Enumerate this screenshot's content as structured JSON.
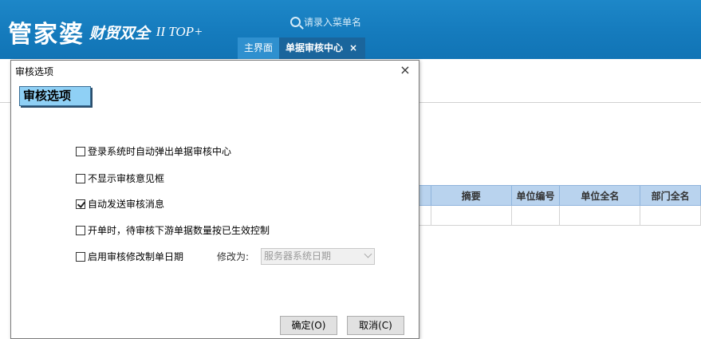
{
  "header": {
    "logo_brand": "管家婆",
    "logo_sub": "财贸双全",
    "logo_version": "II TOP+",
    "search_placeholder": "请录入菜单名",
    "tabs": [
      {
        "label": "主界面"
      },
      {
        "label": "单据审核中心",
        "close": "×"
      }
    ]
  },
  "grid": {
    "columns": [
      "",
      "摘要",
      "单位编号",
      "单位全名",
      "部门全名"
    ],
    "rows": [
      [
        "",
        "",
        "",
        "",
        ""
      ]
    ]
  },
  "dialog": {
    "title": "审核选项",
    "close": "×",
    "section_title": "审核选项",
    "options": [
      {
        "label": "登录系统时自动弹出单据审核中心",
        "checked": false
      },
      {
        "label": "不显示审核意见框",
        "checked": false
      },
      {
        "label": "自动发送审核消息",
        "checked": true
      },
      {
        "label": "开单时，待审核下游单据数量按已生效控制",
        "checked": false
      },
      {
        "label": "启用审核修改制单日期",
        "checked": false
      }
    ],
    "modify_label": "修改为:",
    "modify_select_value": "服务器系统日期",
    "ok_label": "确定(O)",
    "cancel_label": "取消(C)"
  },
  "colors": {
    "header_blue": "#157bbd",
    "active_tab": "#1a659c",
    "section_tag": "#8fd0f5",
    "grid_header": "#b9d3ee"
  },
  "icons": [
    "search-icon",
    "close-icon",
    "chevron-down-icon",
    "checkbox-icon"
  ]
}
